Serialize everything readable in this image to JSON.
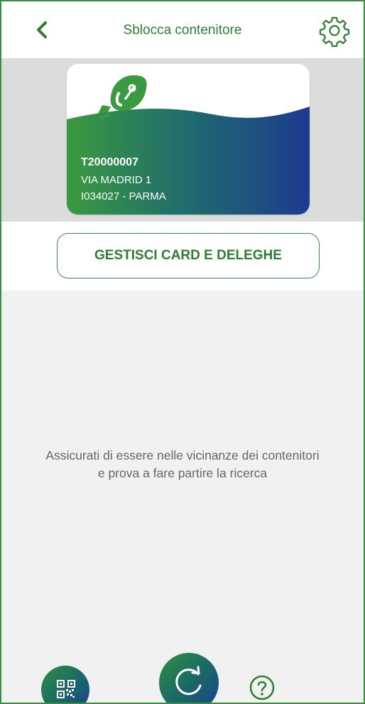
{
  "header": {
    "title": "Sblocca contenitore",
    "back_icon": "chevron-left-icon",
    "settings_icon": "gear-icon"
  },
  "card": {
    "id": "T20000007",
    "address": "VIA MADRID 1",
    "city": "I034027 - PARMA",
    "logo_icon": "leaf-logo"
  },
  "manage_button": {
    "label": "GESTISCI CARD E DELEGHE"
  },
  "main": {
    "message_line1": "Assicurati di essere nelle vicinanze dei contenitori",
    "message_line2": "e prova a fare partire la ricerca"
  },
  "actions": {
    "qr_icon": "qr-code-icon",
    "refresh_icon": "refresh-icon",
    "help_icon": "help-icon"
  },
  "colors": {
    "primary_green": "#2e7d32",
    "card_gradient_start": "#3a9a3f",
    "card_gradient_end": "#1e3a8f",
    "background": "#f1f1f1"
  }
}
